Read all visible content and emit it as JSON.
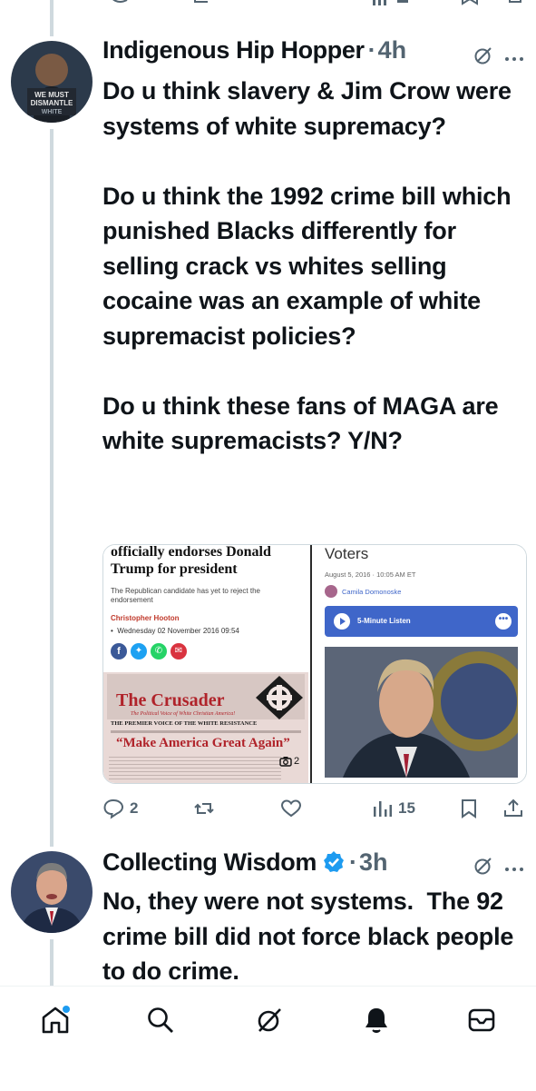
{
  "colors": {
    "accent": "#1d9bf0",
    "muted": "#536471",
    "text": "#0f1419",
    "thread": "#cfd9de",
    "listen_bar": "#3f66c9"
  },
  "post1": {
    "author": "Indigenous Hip Hopper",
    "separator": "·",
    "time": "4h",
    "avatar_text": "WE MUST DISMANTLE WHITE SUPREMACY",
    "paragraphs": [
      "Do u think slavery & Jim Crow were systems of white supremacy?",
      "Do u think the 1992 crime bill which punished Blacks differently for selling crack vs whites selling cocaine was an example of white supremacist policies?",
      "Do u think these fans of MAGA are white supremacists? Y/N?"
    ],
    "media_left": {
      "headline": "officially endorses Donald Trump for president",
      "subhead": "The Republican candidate has yet to reject the endorsement",
      "byline": "Christopher Hooton",
      "date": "Wednesday 02 November 2016 09:54",
      "masthead": "The Crusader",
      "masthead_sub": "The Political Voice of White Christian America!",
      "banner": "THE PREMIER VOICE OF THE WHITE RESISTANCE",
      "slogan": "“Make America Great Again”",
      "photo_count": "2"
    },
    "media_right": {
      "title": "Voters",
      "date": "August 5, 2016 · 10:05 AM ET",
      "author": "Camila Domonoske",
      "listen_label": "5-Minute Listen"
    },
    "actions": {
      "replies": "2",
      "reposts": "",
      "likes": "",
      "views": "15"
    }
  },
  "post2": {
    "author": "Collecting Wisdom",
    "separator": "·",
    "time": "3h",
    "text": "No, they were not systems.  The 92 crime bill did not force black people to do crime."
  },
  "nav": {
    "items": [
      "home-icon",
      "search-icon",
      "grok-icon",
      "notifications-icon",
      "messages-icon"
    ]
  }
}
